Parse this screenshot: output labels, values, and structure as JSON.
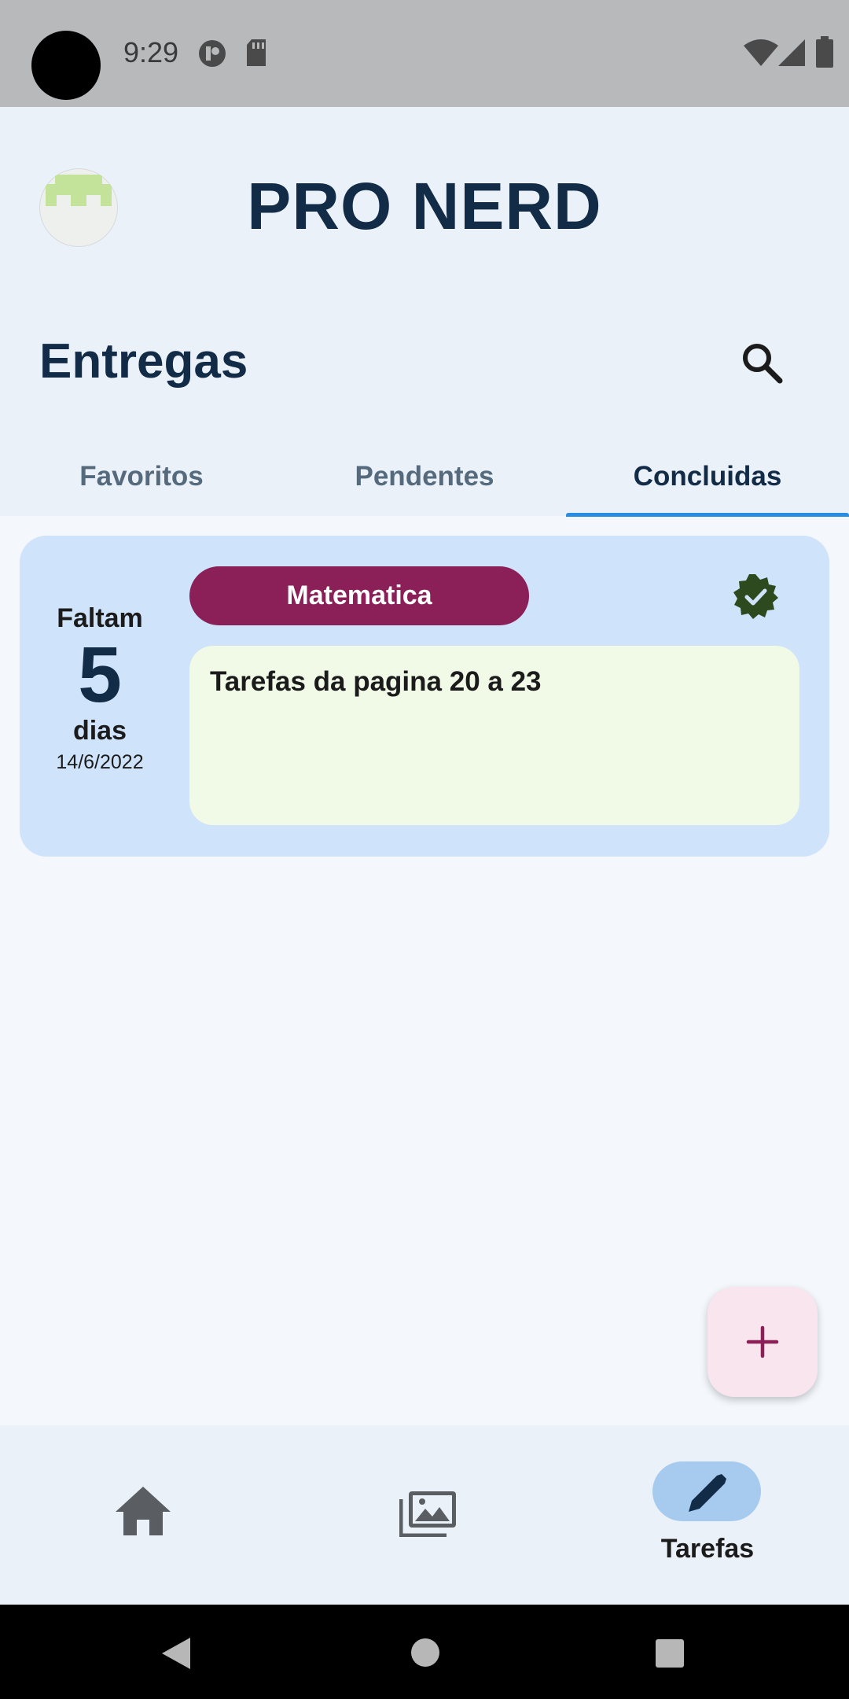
{
  "status_bar": {
    "time": "9:29",
    "icons": [
      "notification-app-icon",
      "sd-card-icon",
      "wifi-icon",
      "signal-icon",
      "battery-icon"
    ]
  },
  "header": {
    "app_title": "PRO NERD",
    "avatar_icon": "pixel-invader-avatar"
  },
  "section": {
    "title": "Entregas",
    "search_icon": "search-icon"
  },
  "tabs": [
    {
      "label": "Favoritos",
      "active": false
    },
    {
      "label": "Pendentes",
      "active": false
    },
    {
      "label": "Concluidas",
      "active": true
    }
  ],
  "tasks": [
    {
      "due_label": "Faltam",
      "days_left": "5",
      "days_unit": "dias",
      "due_date": "14/6/2022",
      "subject": "Matematica",
      "description": "Tarefas da pagina 20 a 23",
      "status_icon": "verified-check-icon",
      "completed": true
    }
  ],
  "fab": {
    "icon": "plus-icon"
  },
  "bottom_nav": [
    {
      "icon": "home-icon",
      "label": "",
      "active": false
    },
    {
      "icon": "gallery-icon",
      "label": "",
      "active": false
    },
    {
      "icon": "pencil-icon",
      "label": "Tarefas",
      "active": true
    }
  ],
  "system_nav": [
    "back-icon",
    "home-circle-icon",
    "recents-icon"
  ],
  "colors": {
    "primary_text": "#122b47",
    "subject_pill": "#8b1f57",
    "card_bg": "#cfe3fb",
    "task_box_bg": "#f1f9e7",
    "tab_indicator": "#2a8de4",
    "done_badge": "#2d4a1e",
    "fab_bg": "#f8e5ee",
    "nav_active_pill": "#a6cbee"
  }
}
